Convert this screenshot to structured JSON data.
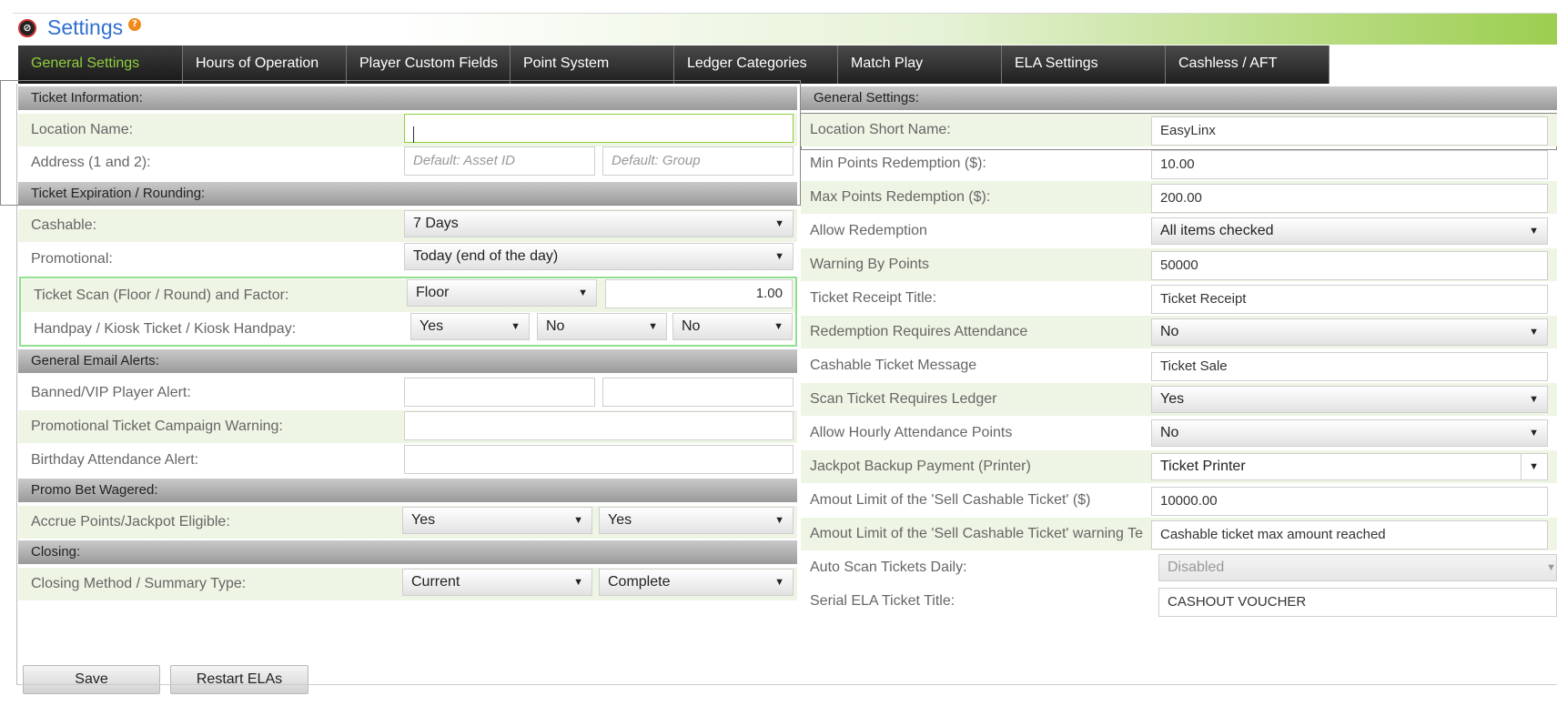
{
  "window": {
    "title": "Settings"
  },
  "tabs": [
    {
      "label": "General Settings"
    },
    {
      "label": "Hours of Operation"
    },
    {
      "label": "Player Custom Fields"
    },
    {
      "label": "Point System"
    },
    {
      "label": "Ledger Categories"
    },
    {
      "label": "Match Play"
    },
    {
      "label": "ELA Settings"
    },
    {
      "label": "Cashless / AFT"
    }
  ],
  "left": {
    "ticket_info": {
      "header": "Ticket Information:",
      "location_name_label": "Location Name:",
      "location_name_value": "",
      "address_label": "Address (1 and 2):",
      "address1_placeholder": "Default: Asset ID",
      "address2_placeholder": "Default: Group"
    },
    "expiration": {
      "header": "Ticket Expiration / Rounding:",
      "cashable_label": "Cashable:",
      "cashable_value": "7 Days",
      "promotional_label": "Promotional:",
      "promotional_value": "Today (end of the day)",
      "scan_label": "Ticket Scan (Floor / Round) and Factor:",
      "scan_value": "Floor",
      "factor_value": "1.00",
      "handpay_label": "Handpay / Kiosk Ticket / Kiosk Handpay:",
      "handpay_value": "Yes",
      "kiosk_ticket_value": "No",
      "kiosk_handpay_value": "No"
    },
    "email": {
      "header": "General Email Alerts:",
      "banned_label": "Banned/VIP Player Alert:",
      "promo_label": "Promotional Ticket Campaign Warning:",
      "birthday_label": "Birthday Attendance Alert:"
    },
    "promo_bet": {
      "header": "Promo Bet Wagered:",
      "accrue_label": "Accrue Points/Jackpot Eligible:",
      "accrue_points_value": "Yes",
      "jackpot_value": "Yes"
    },
    "closing": {
      "header": "Closing:",
      "method_label": "Closing Method / Summary Type:",
      "method_value": "Current",
      "summary_value": "Complete"
    }
  },
  "right": {
    "header": "General Settings:",
    "rows": [
      {
        "label": "Location Short Name:",
        "value": "EasyLinx"
      },
      {
        "label": "Min Points Redemption ($):",
        "value": "10.00"
      },
      {
        "label": "Max Points Redemption ($):",
        "value": "200.00"
      },
      {
        "label": "Allow Redemption",
        "value": "All items checked"
      },
      {
        "label": "Warning By Points",
        "value": "50000"
      },
      {
        "label": "Ticket Receipt Title:",
        "value": "Ticket Receipt"
      },
      {
        "label": "Redemption Requires Attendance",
        "value": "No"
      },
      {
        "label": "Cashable Ticket Message",
        "value": "Ticket Sale"
      },
      {
        "label": "Scan Ticket Requires Ledger",
        "value": "Yes"
      },
      {
        "label": "Allow Hourly Attendance Points",
        "value": "No"
      },
      {
        "label": "Jackpot Backup Payment (Printer)",
        "value": "Ticket Printer"
      },
      {
        "label": "Amout Limit of the 'Sell Cashable Ticket' ($)",
        "value": "10000.00"
      },
      {
        "label": "Amout Limit of the 'Sell Cashable Ticket' warning Te",
        "value": "Cashable ticket max amount reached"
      },
      {
        "label": "Auto Scan Tickets Daily:",
        "value": "Disabled"
      },
      {
        "label": "Serial ELA Ticket Title:",
        "value": "CASHOUT VOUCHER"
      }
    ]
  },
  "buttons": {
    "save": "Save",
    "restart": "Restart ELAs"
  },
  "colors": {
    "accent_green": "#8fcf3c",
    "title_blue": "#2f6fd1",
    "row_tint": "#eef5e4"
  }
}
